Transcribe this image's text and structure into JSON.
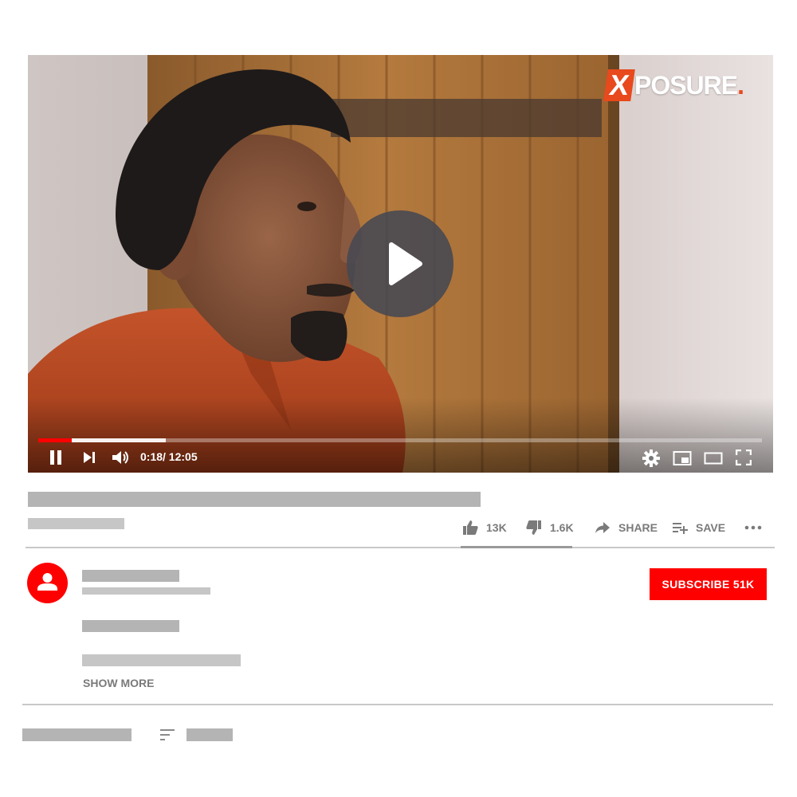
{
  "player": {
    "logo": {
      "mark": "X",
      "word": "POSURE",
      "dot": "."
    },
    "time_display": "0:18/ 12:05",
    "progress": {
      "played_fraction": 0.046,
      "buffered_fraction": 0.176
    },
    "controls": [
      "pause-icon",
      "next-icon",
      "volume-icon",
      "settings-icon",
      "miniplayer-icon",
      "theater-icon",
      "fullscreen-icon"
    ]
  },
  "actions": {
    "likes": "13K",
    "dislikes": "1.6K",
    "share": "SHARE",
    "save": "SAVE",
    "more_icon": "more-icon"
  },
  "channel": {
    "subscribe_label": "SUBSCRIBE 51K"
  },
  "description": {
    "show_more": "SHOW MORE"
  },
  "colors": {
    "accent": "#ff0000",
    "logo_orange": "#e8491d",
    "placeholder": "#b4b4b4",
    "muted_text": "#7a7a7a"
  }
}
